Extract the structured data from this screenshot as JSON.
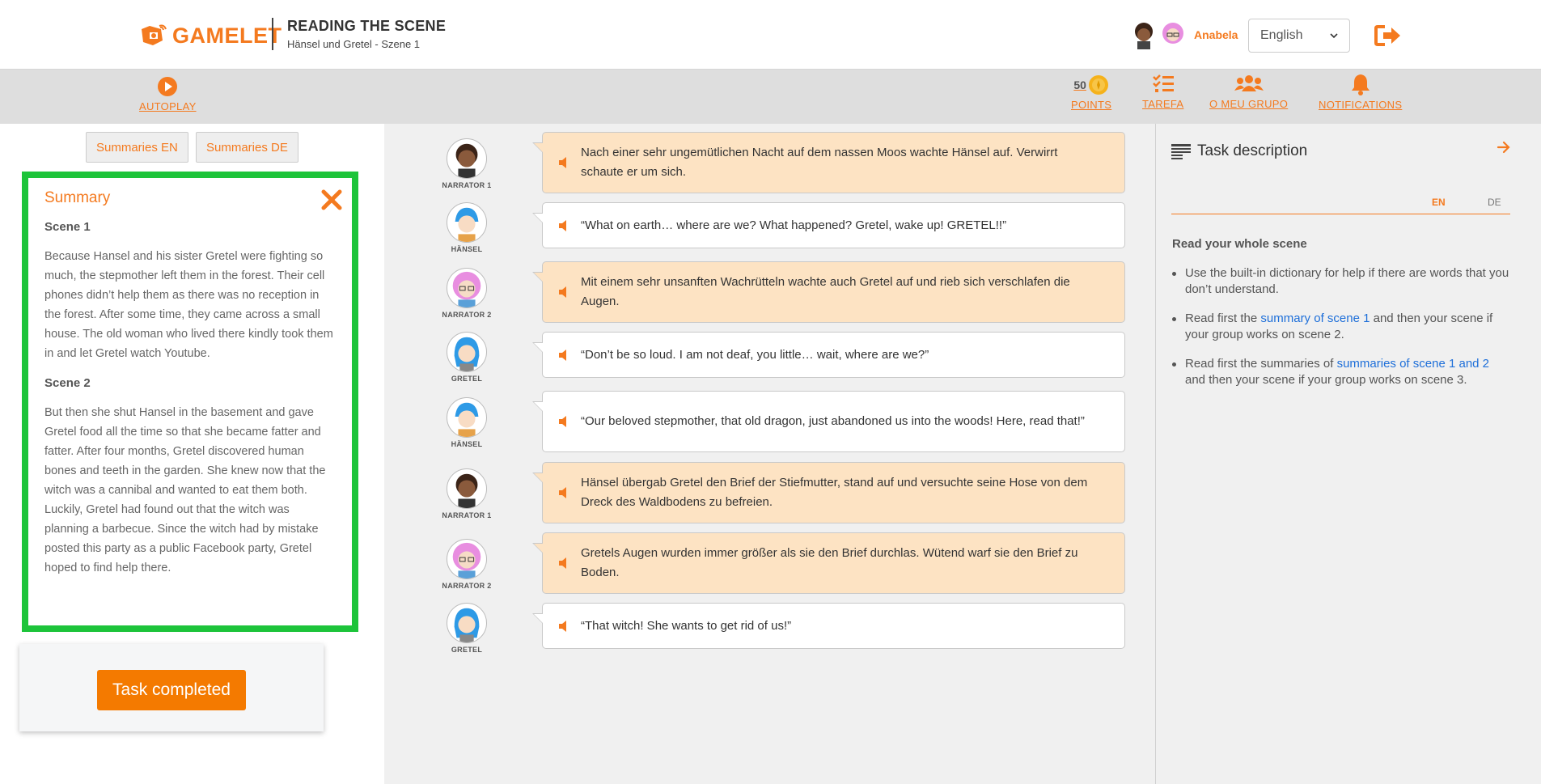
{
  "header": {
    "logo_text": "GAMELET",
    "title": "READING THE SCENE",
    "subtitle": "Hänsel und Gretel - Szene 1",
    "user_name": "Anabela",
    "language": "English"
  },
  "toolbar": {
    "autoplay": "AUTOPLAY",
    "points_value": "50",
    "points": "POINTS",
    "tarefa": "TAREFA",
    "group": "O MEU GRUPO",
    "notifications": "NOTIFICATIONS"
  },
  "summary": {
    "tab_en": "Summaries EN",
    "tab_de": "Summaries DE",
    "title": "Summary",
    "scene1_title": "Scene 1",
    "scene1_text": "Because Hansel and his sister Gretel were fighting so much, the stepmother left them in the forest. Their cell phones didn’t help them as there was no reception in the forest. After some time, they came across a small house. The old woman who lived there kindly took them in and let Gretel watch Youtube.",
    "scene2_title": "Scene 2",
    "scene2_text": "But then she shut Hansel in the basement and gave Gretel food all the time so that she became fatter and fatter. After four months, Gretel discovered human bones and teeth in the garden. She knew now that the witch was a cannibal and wanted to eat them both. Luckily, Gretel had found out that the witch was planning a barbecue. Since the witch had by mistake posted this party as a public Facebook party, Gretel hoped to find help there.",
    "task_button": "Task completed"
  },
  "dialogue": [
    {
      "speaker": "NARRATOR 1",
      "type": "narr",
      "text": "Nach einer sehr ungemütlichen Nacht auf dem nassen Moos wachte Hänsel auf. Verwirrt schaute er um sich."
    },
    {
      "speaker": "HÄNSEL",
      "type": "char",
      "text": "“What on earth… where are we? What happened? Gretel, wake up! GRETEL!!”"
    },
    {
      "speaker": "NARRATOR 2",
      "type": "narr",
      "text": "Mit einem sehr unsanften Wachrütteln wachte auch Gretel auf und rieb sich verschlafen die Augen."
    },
    {
      "speaker": "GRETEL",
      "type": "char",
      "text": "“Don’t be so loud. I am not deaf, you little… wait, where are we?”"
    },
    {
      "speaker": "HÄNSEL",
      "type": "char",
      "text": "“Our beloved stepmother, that old dragon, just abandoned us into the woods! Here, read that!”"
    },
    {
      "speaker": "NARRATOR 1",
      "type": "narr",
      "text": "Hänsel übergab Gretel den Brief der Stiefmutter, stand auf und versuchte seine Hose von dem Dreck des Waldbodens zu befreien."
    },
    {
      "speaker": "NARRATOR 2",
      "type": "narr",
      "text": "Gretels Augen wurden immer größer als sie den Brief durchlas. Wütend warf sie den Brief zu Boden."
    },
    {
      "speaker": "GRETEL",
      "type": "char",
      "text": "“That witch! She wants to get rid of us!”"
    }
  ],
  "task": {
    "title": "Task description",
    "tab_en": "EN",
    "tab_de": "DE",
    "heading": "Read your whole scene",
    "item1": "Use the built-in dictionary for help if there are words that you don’t understand.",
    "item2_pre": "Read first the ",
    "item2_link": "summary of scene 1",
    "item2_post": " and then your scene if your group works on scene 2.",
    "item3_pre": "Read first the summaries of ",
    "item3_link": "summaries of scene 1 and 2",
    "item3_post": " and then your scene if your group works on scene 3."
  },
  "colors": {
    "accent": "#f47a1f",
    "highlight_border": "#1dc43a",
    "narrator_bubble": "#fde3c3",
    "link": "#1e6fd9"
  }
}
